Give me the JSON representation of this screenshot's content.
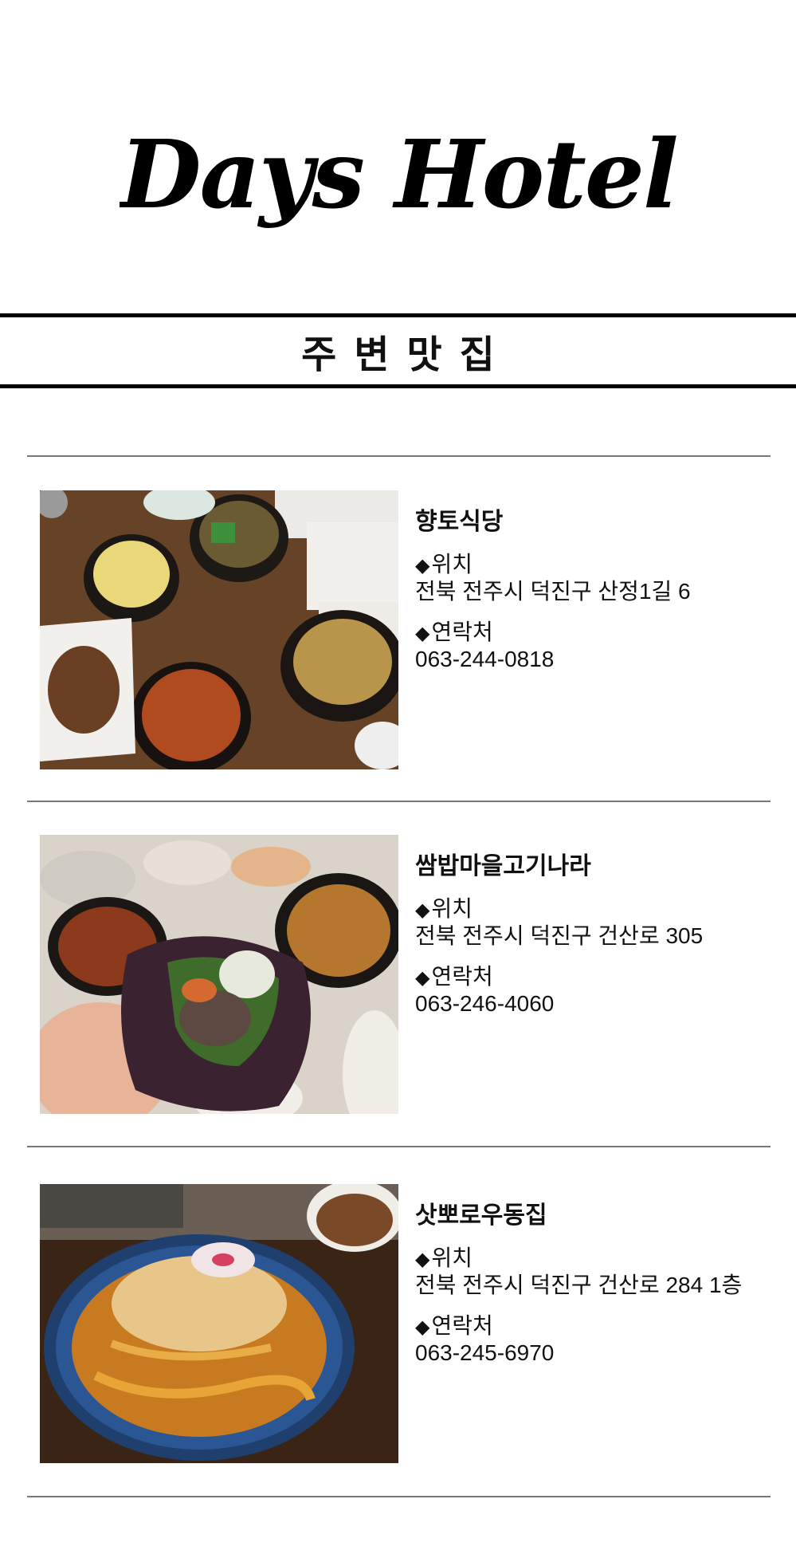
{
  "brand": {
    "name": "Days Hotel"
  },
  "section": {
    "title": "주변맛집"
  },
  "restaurants": [
    {
      "name": "향토식당",
      "location_label": "위치",
      "location": "전북 전주시 덕진구 산정1길 6",
      "contact_label": "연락처",
      "phone": "063-244-0818"
    },
    {
      "name": "쌈밥마을고기나라",
      "location_label": "위치",
      "location": "전북 전주시 덕진구 건산로 305",
      "contact_label": "연락처",
      "phone": "063-246-4060"
    },
    {
      "name": "삿뽀로우동집",
      "location_label": "위치",
      "location": "전북 전주시 덕진구 건산로 284 1층",
      "contact_label": "연락처",
      "phone": "063-245-6970"
    }
  ],
  "icons": {
    "bullet": "diamond"
  }
}
